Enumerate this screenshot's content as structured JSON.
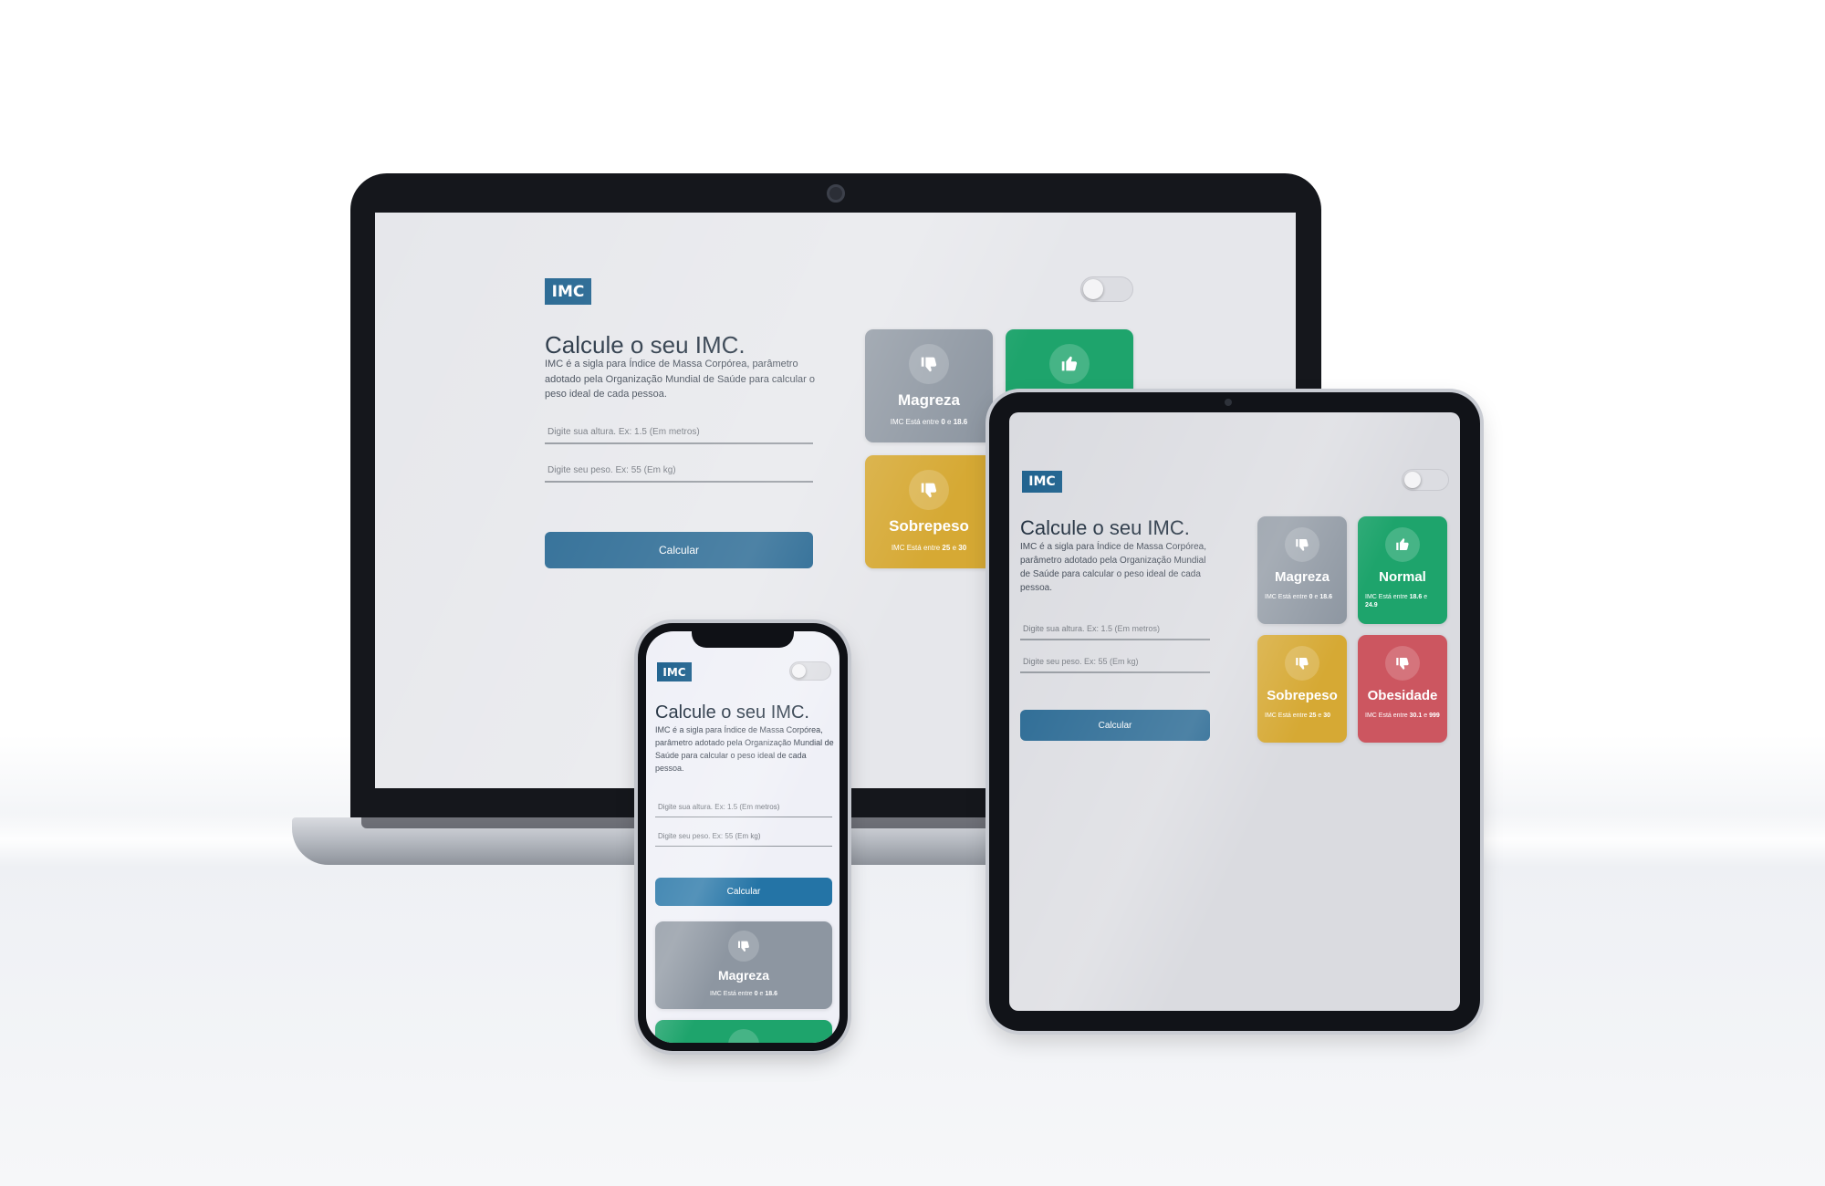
{
  "app": {
    "logo": "IMC",
    "title": "Calcule o seu IMC.",
    "description": "IMC é a sigla para Índice de Massa Corpórea, parâmetro adotado pela Organização Mundial de Saúde para calcular o peso ideal de cada pessoa.",
    "height_placeholder": "Digite sua altura. Ex: 1.5 (Em metros)",
    "weight_placeholder": "Digite seu peso. Ex: 55 (Em kg)",
    "calculate_label": "Calcular",
    "theme_toggle": "off"
  },
  "range_prefix": "IMC Está entre",
  "range_joiner": "e",
  "cards": [
    {
      "title": "Magreza",
      "min": "0",
      "max": "18.6",
      "color": "#8d96a1",
      "icon": "thumbs-down-icon"
    },
    {
      "title": "Normal",
      "min": "18.6",
      "max": "24.9",
      "color": "#1ea46c",
      "icon": "thumbs-up-icon"
    },
    {
      "title": "Sobrepeso",
      "min": "25",
      "max": "30",
      "color": "#d6a934",
      "icon": "thumbs-down-icon"
    },
    {
      "title": "Obesidade",
      "min": "30.1",
      "max": "999",
      "color": "#cc5660",
      "icon": "thumbs-down-icon"
    }
  ]
}
